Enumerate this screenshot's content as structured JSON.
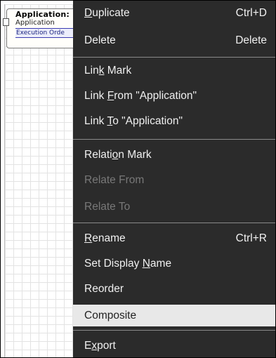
{
  "node": {
    "title": "Application:",
    "type": "Application",
    "exec_label": "Execution Orde"
  },
  "menu": {
    "items": [
      {
        "label_pre": "",
        "mnemonic": "D",
        "label_post": "uplicate",
        "shortcut": "Ctrl+D"
      },
      {
        "label_pre": "Delete",
        "mnemonic": "",
        "label_post": "",
        "shortcut": "Delete"
      },
      {
        "label_pre": "Lin",
        "mnemonic": "k",
        "label_post": " Mark",
        "shortcut": ""
      },
      {
        "label_pre": "Link ",
        "mnemonic": "F",
        "label_post": "rom \"Application\"",
        "shortcut": ""
      },
      {
        "label_pre": "Link ",
        "mnemonic": "T",
        "label_post": "o \"Application\"",
        "shortcut": ""
      },
      {
        "label_pre": "Relati",
        "mnemonic": "o",
        "label_post": "n Mark",
        "shortcut": ""
      },
      {
        "label_pre": "Relate From",
        "mnemonic": "",
        "label_post": "",
        "shortcut": "",
        "disabled": true
      },
      {
        "label_pre": "Relate To",
        "mnemonic": "",
        "label_post": "",
        "shortcut": "",
        "disabled": true
      },
      {
        "label_pre": "",
        "mnemonic": "R",
        "label_post": "ename",
        "shortcut": "Ctrl+R"
      },
      {
        "label_pre": "Set Display ",
        "mnemonic": "N",
        "label_post": "ame",
        "shortcut": ""
      },
      {
        "label_pre": "Reorder",
        "mnemonic": "",
        "label_post": "",
        "shortcut": ""
      },
      {
        "label_pre": "Composite",
        "mnemonic": "",
        "label_post": "",
        "shortcut": "",
        "highlighted": true
      },
      {
        "label_pre": "E",
        "mnemonic": "x",
        "label_post": "port",
        "shortcut": ""
      }
    ]
  }
}
